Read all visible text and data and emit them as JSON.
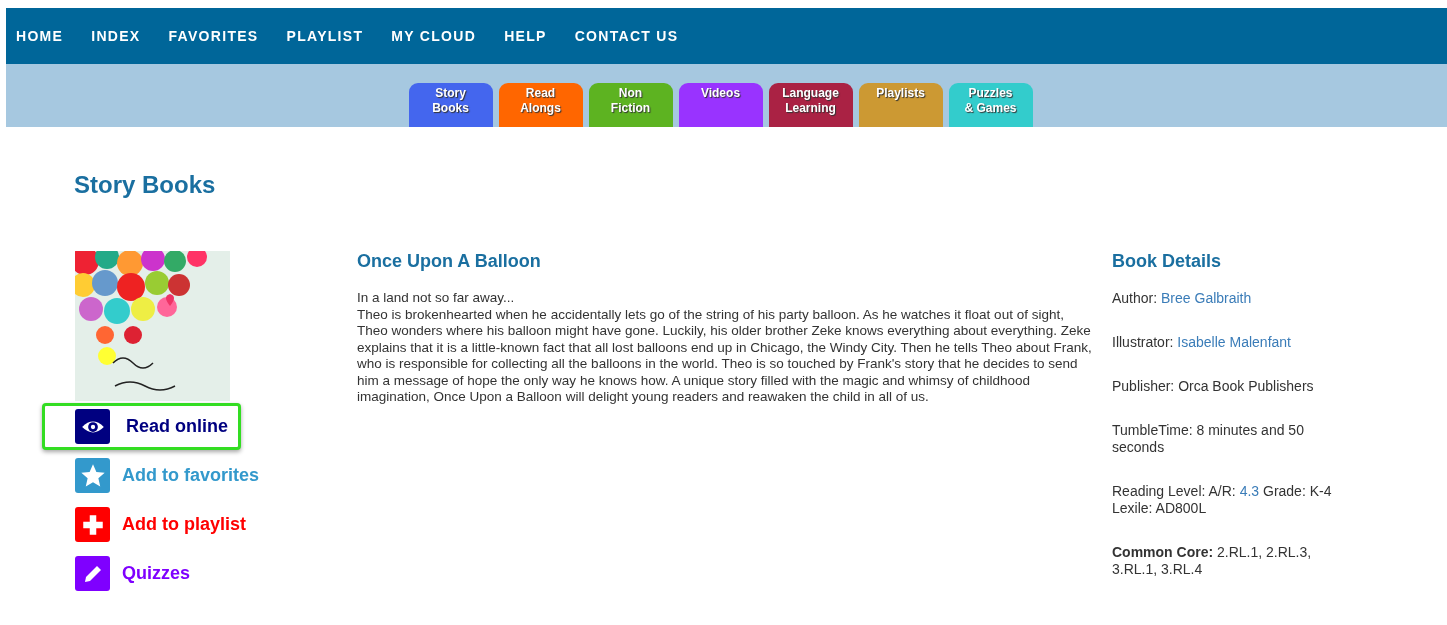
{
  "nav": [
    "HOME",
    "INDEX",
    "FAVORITES",
    "PLAYLIST",
    "MY CLOUD",
    "HELP",
    "CONTACT US"
  ],
  "categories": [
    {
      "lines": [
        "Story",
        "Books"
      ],
      "color": "#4466ee"
    },
    {
      "lines": [
        "Read",
        "Alongs"
      ],
      "color": "#ff6600"
    },
    {
      "lines": [
        "Non",
        "Fiction"
      ],
      "color": "#5db321"
    },
    {
      "lines": [
        "Videos"
      ],
      "color": "#9933ff"
    },
    {
      "lines": [
        "Language",
        "Learning"
      ],
      "color": "#aa2244"
    },
    {
      "lines": [
        "Playlists"
      ],
      "color": "#cc9933"
    },
    {
      "lines": [
        "Puzzles",
        "& Games"
      ],
      "color": "#33cccc"
    }
  ],
  "page_title": "Story Books",
  "actions": [
    {
      "kind": "eye",
      "label": "Read online",
      "color": "#000080",
      "highlighted": true
    },
    {
      "kind": "star",
      "label": "Add to favorites",
      "color": "#3399cc",
      "highlighted": false
    },
    {
      "kind": "plus",
      "label": "Add to playlist",
      "color": "#ff0000",
      "highlighted": false
    },
    {
      "kind": "pencil",
      "label": "Quizzes",
      "color": "#7f00ff",
      "highlighted": false
    }
  ],
  "book": {
    "title": "Once Upon A Balloon",
    "description": [
      "In a land not so far away...",
      "Theo is brokenhearted when he accidentally lets go of the string of his party balloon. As he watches it float out of sight, Theo wonders where his balloon might have gone. Luckily, his older brother Zeke knows everything about everything. Zeke explains that it is a little-known fact that all lost balloons end up in Chicago, the Windy City. Then he tells Theo about Frank, who is responsible for collecting all the balloons in the world. Theo is so touched by Frank's story that he decides to send him a message of hope the only way he knows how. A unique story filled with the magic and whimsy of childhood imagination, Once Upon a Balloon will delight young readers and reawaken the child in all of us."
    ]
  },
  "details": {
    "title": "Book Details",
    "items": [
      [
        {
          "text": "Author: ",
          "link": false
        },
        {
          "text": "Bree Galbraith",
          "link": true
        }
      ],
      [
        {
          "text": "Illustrator: ",
          "link": false
        },
        {
          "text": "Isabelle Malenfant",
          "link": true
        }
      ],
      [
        {
          "text": "Publisher: Orca Book Publishers",
          "link": false
        }
      ],
      [
        {
          "text": "TumbleTime: 8 minutes and 50 seconds",
          "link": false
        }
      ],
      [
        {
          "text": "Reading Level:  A/R: ",
          "link": false
        },
        {
          "text": "4.3",
          "link": true
        },
        {
          "text": " Grade: K-4 Lexile: AD800L",
          "link": false
        }
      ],
      [
        {
          "text": "**Common Core:** 2.RL.1, 2.RL.3, 3.RL.1, 3.RL.4",
          "link": false
        }
      ]
    ]
  }
}
